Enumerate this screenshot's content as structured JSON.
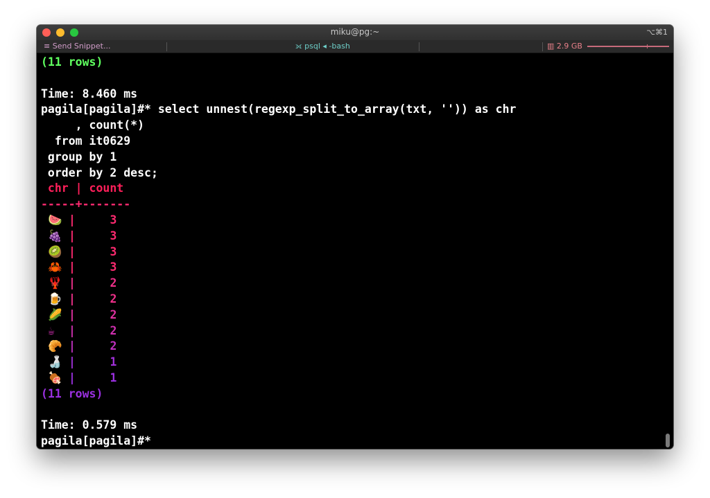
{
  "window": {
    "title": "miku@pg:~",
    "shortcut": "⌥⌘1"
  },
  "statusbar": {
    "snippet_icon": "≡",
    "snippet_label": "Send Snippet...",
    "tab_icon": "⟗",
    "tab_label": "psql ◂ -bash",
    "mem_icon": "▥",
    "mem_label": "2.9 GB"
  },
  "terminal": {
    "rows_top": "(11 rows)",
    "time1": "Time: 8.460 ms",
    "query": [
      "pagila[pagila]#* select unnest(regexp_split_to_array(txt, '')) as chr",
      "     , count(*)",
      "  from it0629",
      " group by 1",
      " order by 2 desc;"
    ],
    "header": " chr | count",
    "separator": "-----+-------",
    "rows": [
      {
        "chr": "🍉",
        "count": "3",
        "color": "#ff2a70"
      },
      {
        "chr": "🍇",
        "count": "3",
        "color": "#ff2a70"
      },
      {
        "chr": "🥝",
        "count": "3",
        "color": "#ff2a70"
      },
      {
        "chr": "🦀",
        "count": "3",
        "color": "#ff2a70"
      },
      {
        "chr": "🦞",
        "count": "2",
        "color": "#f0308a"
      },
      {
        "chr": "🍺",
        "count": "2",
        "color": "#f0308a"
      },
      {
        "chr": "🌽",
        "count": "2",
        "color": "#e030a0"
      },
      {
        "chr": "☕",
        "count": "2",
        "color": "#d030b0"
      },
      {
        "chr": "🥐",
        "count": "2",
        "color": "#c030c0"
      },
      {
        "chr": "🍶",
        "count": "1",
        "color": "#a030d8"
      },
      {
        "chr": "🍖",
        "count": "1",
        "color": "#9a30e0"
      }
    ],
    "rows_bottom": "(11 rows)",
    "rows_bottom_color": "#9a30e0",
    "time2": "Time: 0.579 ms",
    "prompt": "pagila[pagila]#*"
  },
  "colors": {
    "prompt_ok": "#5fff5f",
    "header": "#ff1f5a",
    "separator": "#ff2a70"
  }
}
